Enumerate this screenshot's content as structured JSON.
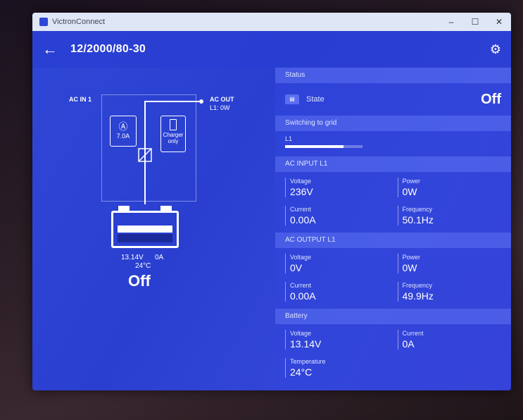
{
  "window": {
    "title": "VictronConnect",
    "min": "–",
    "max": "☐",
    "close": "✕"
  },
  "appbar": {
    "back_icon": "arrow-left-icon",
    "title": "12/2000/80-30",
    "settings_icon": "gear-icon"
  },
  "diagram": {
    "ac_in": "AC IN 1",
    "ac_out": "AC OUT",
    "ac_out_load": "L1: 0W",
    "input_current": "7.0A",
    "charger_mode": "Charger only",
    "battery_voltage": "13.14V",
    "battery_current": "0A",
    "battery_temp": "24°C",
    "state": "Off"
  },
  "status": {
    "header": "Status",
    "state_label": "State",
    "state_value": "Off",
    "grid_header": "Switching to grid",
    "grid_line": "L1",
    "grid_level": 0.75
  },
  "ac_input": {
    "header": "AC INPUT L1",
    "voltage_label": "Voltage",
    "voltage": "236V",
    "power_label": "Power",
    "power": "0W",
    "current_label": "Current",
    "current": "0.00A",
    "frequency_label": "Frequency",
    "frequency": "50.1Hz"
  },
  "ac_output": {
    "header": "AC OUTPUT L1",
    "voltage_label": "Voltage",
    "voltage": "0V",
    "power_label": "Power",
    "power": "0W",
    "current_label": "Current",
    "current": "0.00A",
    "frequency_label": "Frequency",
    "frequency": "49.9Hz"
  },
  "battery": {
    "header": "Battery",
    "voltage_label": "Voltage",
    "voltage": "13.14V",
    "current_label": "Current",
    "current": "0A",
    "temperature_label": "Temperature",
    "temperature": "24°C"
  }
}
